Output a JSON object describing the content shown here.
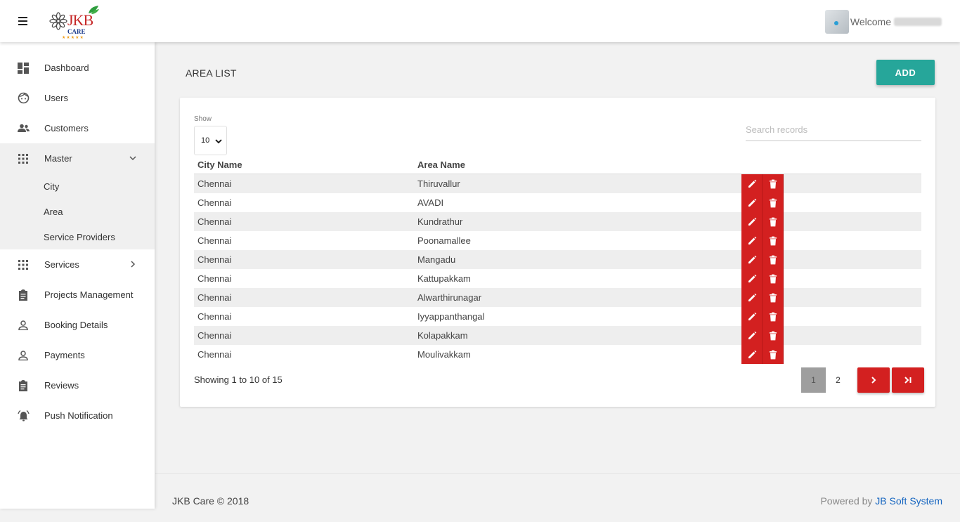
{
  "header": {
    "brand": "JKB",
    "brand_sub": "CARE",
    "welcome": "Welcome"
  },
  "sidebar": {
    "items": [
      {
        "label": "Dashboard",
        "icon": "dashboard-icon"
      },
      {
        "label": "Users",
        "icon": "face-icon"
      },
      {
        "label": "Customers",
        "icon": "people-icon"
      },
      {
        "label": "Master",
        "icon": "apps-grid-icon"
      },
      {
        "label": "Services",
        "icon": "apps-grid-icon"
      },
      {
        "label": "Projects Management",
        "icon": "clipboard-icon"
      },
      {
        "label": "Booking Details",
        "icon": "person-outline-icon"
      },
      {
        "label": "Payments",
        "icon": "person-outline-icon"
      },
      {
        "label": "Reviews",
        "icon": "clipboard-icon"
      },
      {
        "label": "Push Notification",
        "icon": "alarm-bell-icon"
      }
    ],
    "master_sub": [
      "City",
      "Area",
      "Service Providers"
    ]
  },
  "main": {
    "title": "AREA LIST",
    "add_label": "ADD",
    "show_label": "Show",
    "show_value": "10",
    "search_placeholder": "Search records",
    "columns": [
      "City Name",
      "Area Name"
    ],
    "rows": [
      {
        "city": "Chennai",
        "area": "Thiruvallur"
      },
      {
        "city": "Chennai",
        "area": "AVADI"
      },
      {
        "city": "Chennai",
        "area": "Kundrathur"
      },
      {
        "city": "Chennai",
        "area": "Poonamallee"
      },
      {
        "city": "Chennai",
        "area": "Mangadu"
      },
      {
        "city": "Chennai",
        "area": "Kattupakkam"
      },
      {
        "city": "Chennai",
        "area": "Alwarthirunagar"
      },
      {
        "city": "Chennai",
        "area": "Iyyappanthangal"
      },
      {
        "city": "Chennai",
        "area": "Kolapakkam"
      },
      {
        "city": "Chennai",
        "area": "Moulivakkam"
      }
    ],
    "showing": "Showing 1 to 10 of 15",
    "pages": [
      "1",
      "2"
    ],
    "accent_red": "#d32020",
    "accent_teal": "#26a69a"
  },
  "footer": {
    "copyright": "JKB Care © 2018",
    "powered_prefix": "Powered by",
    "powered_link": "JB Soft System"
  }
}
